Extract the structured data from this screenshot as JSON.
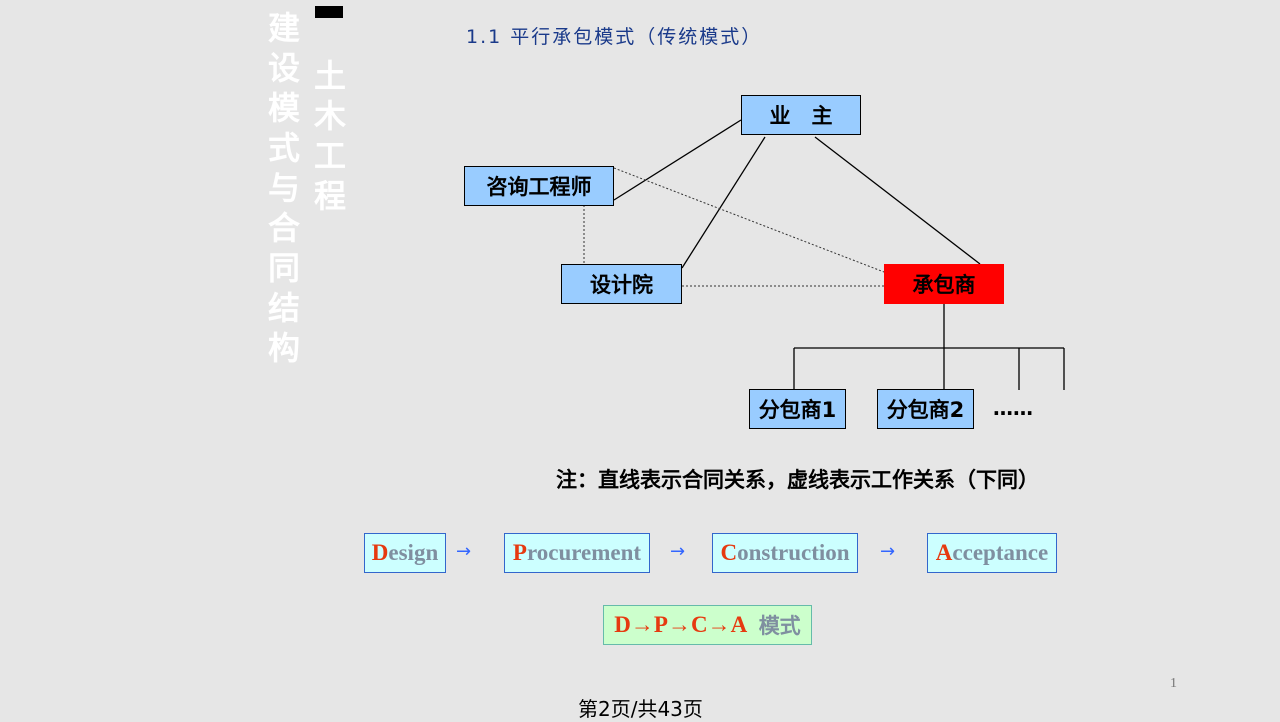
{
  "sidebar": {
    "title_col1": "建设模式与合同结构",
    "title_col2": "土木工程",
    "mark": "一"
  },
  "slide_title": "1.1 平行承包模式（传统模式）",
  "diagram": {
    "owner": "业　主",
    "consultant": "咨询工程师",
    "designer": "设计院",
    "contractor": "承包商",
    "sub1": "分包商1",
    "sub2": "分包商2",
    "more": "……",
    "contractor_color": "#ff0000",
    "box_color": "#99ccff"
  },
  "note": "注：直线表示合同关系，虚线表示工作关系（下同）",
  "flow": [
    {
      "first": "D",
      "rest": "esign"
    },
    {
      "first": "P",
      "rest": "rocurement"
    },
    {
      "first": "C",
      "rest": "onstruction"
    },
    {
      "first": "A",
      "rest": "cceptance"
    }
  ],
  "mode": {
    "seq": "D→P→C→A",
    "label": "模式"
  },
  "slide_number": "1",
  "page_footer": "第2页/共43页"
}
